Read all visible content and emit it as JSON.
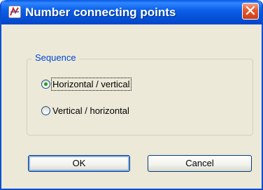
{
  "window": {
    "title": "Number connecting points",
    "close_glyph": "✕",
    "app_icon": "app-logo-icon"
  },
  "sequence": {
    "legend": "Sequence",
    "options": [
      {
        "label": "Horizontal / vertical",
        "checked": true
      },
      {
        "label": "Vertical / horizontal",
        "checked": false
      }
    ]
  },
  "buttons": {
    "ok_label": "OK",
    "cancel_label": "Cancel"
  },
  "colors": {
    "titlebar": "#0b5fe7",
    "close": "#e55b33",
    "group_title": "#0046d5",
    "dialog_bg": "#ece9d8"
  }
}
